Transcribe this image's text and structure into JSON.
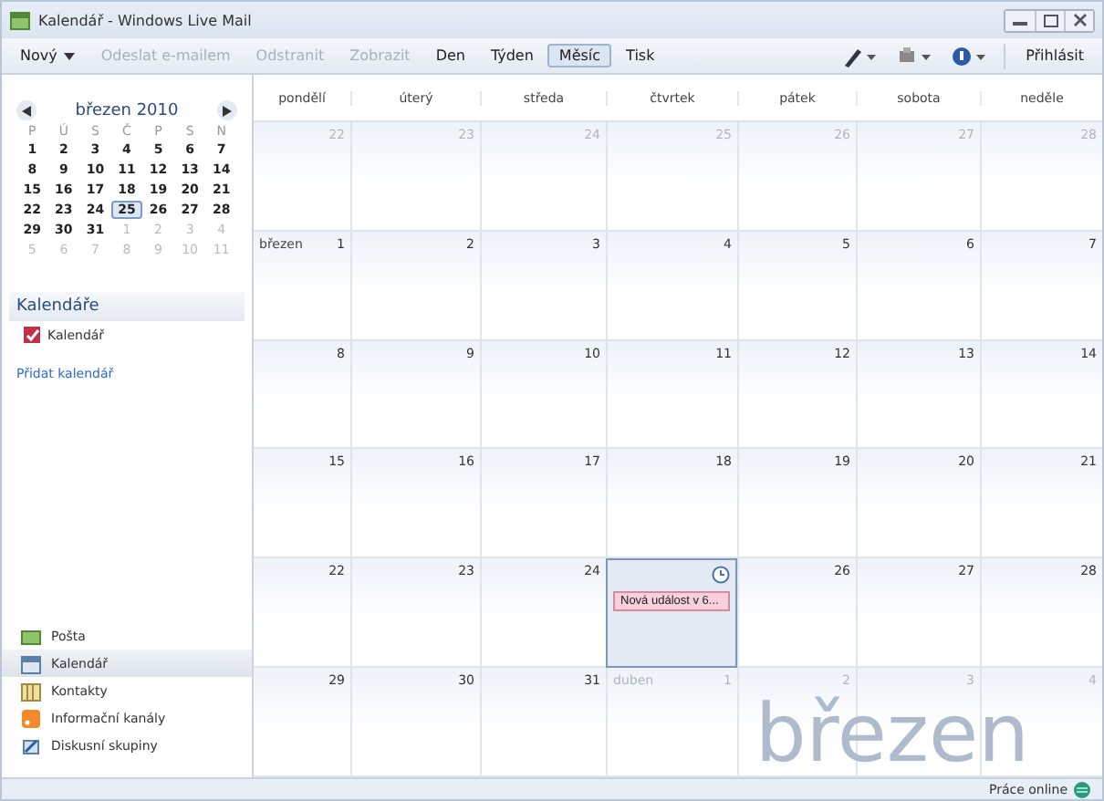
{
  "window": {
    "title": "Kalendář - Windows Live Mail"
  },
  "toolbar": {
    "left": [
      {
        "label": "Nový",
        "kind": "menu",
        "disabled": false,
        "selected": false
      },
      {
        "label": "Odeslat e-mailem",
        "kind": "plain",
        "disabled": true,
        "selected": false
      },
      {
        "label": "Odstranit",
        "kind": "plain",
        "disabled": true,
        "selected": false
      },
      {
        "label": "Zobrazit",
        "kind": "plain",
        "disabled": true,
        "selected": false
      },
      {
        "label": "Den",
        "kind": "plain",
        "disabled": false,
        "selected": false
      },
      {
        "label": "Týden",
        "kind": "plain",
        "disabled": false,
        "selected": false
      },
      {
        "label": "Měsíc",
        "kind": "plain",
        "disabled": false,
        "selected": true
      },
      {
        "label": "Tisk",
        "kind": "plain",
        "disabled": false,
        "selected": false
      }
    ],
    "signin": "Přihlásit"
  },
  "mini_calendar": {
    "title": "březen 2010",
    "weekdays": [
      "P",
      "Ú",
      "S",
      "Č",
      "P",
      "S",
      "N"
    ],
    "weeks": [
      [
        {
          "d": "1",
          "other": false,
          "today": false
        },
        {
          "d": "2",
          "other": false,
          "today": false
        },
        {
          "d": "3",
          "other": false,
          "today": false
        },
        {
          "d": "4",
          "other": false,
          "today": false
        },
        {
          "d": "5",
          "other": false,
          "today": false
        },
        {
          "d": "6",
          "other": false,
          "today": false
        },
        {
          "d": "7",
          "other": false,
          "today": false
        }
      ],
      [
        {
          "d": "8",
          "other": false,
          "today": false
        },
        {
          "d": "9",
          "other": false,
          "today": false
        },
        {
          "d": "10",
          "other": false,
          "today": false
        },
        {
          "d": "11",
          "other": false,
          "today": false
        },
        {
          "d": "12",
          "other": false,
          "today": false
        },
        {
          "d": "13",
          "other": false,
          "today": false
        },
        {
          "d": "14",
          "other": false,
          "today": false
        }
      ],
      [
        {
          "d": "15",
          "other": false,
          "today": false
        },
        {
          "d": "16",
          "other": false,
          "today": false
        },
        {
          "d": "17",
          "other": false,
          "today": false
        },
        {
          "d": "18",
          "other": false,
          "today": false
        },
        {
          "d": "19",
          "other": false,
          "today": false
        },
        {
          "d": "20",
          "other": false,
          "today": false
        },
        {
          "d": "21",
          "other": false,
          "today": false
        }
      ],
      [
        {
          "d": "22",
          "other": false,
          "today": false
        },
        {
          "d": "23",
          "other": false,
          "today": false
        },
        {
          "d": "24",
          "other": false,
          "today": false
        },
        {
          "d": "25",
          "other": false,
          "today": true
        },
        {
          "d": "26",
          "other": false,
          "today": false
        },
        {
          "d": "27",
          "other": false,
          "today": false
        },
        {
          "d": "28",
          "other": false,
          "today": false
        }
      ],
      [
        {
          "d": "29",
          "other": false,
          "today": false
        },
        {
          "d": "30",
          "other": false,
          "today": false
        },
        {
          "d": "31",
          "other": false,
          "today": false
        },
        {
          "d": "1",
          "other": true,
          "today": false
        },
        {
          "d": "2",
          "other": true,
          "today": false
        },
        {
          "d": "3",
          "other": true,
          "today": false
        },
        {
          "d": "4",
          "other": true,
          "today": false
        }
      ],
      [
        {
          "d": "5",
          "other": true,
          "today": false
        },
        {
          "d": "6",
          "other": true,
          "today": false
        },
        {
          "d": "7",
          "other": true,
          "today": false
        },
        {
          "d": "8",
          "other": true,
          "today": false
        },
        {
          "d": "9",
          "other": true,
          "today": false
        },
        {
          "d": "10",
          "other": true,
          "today": false
        },
        {
          "d": "11",
          "other": true,
          "today": false
        }
      ]
    ]
  },
  "calendars": {
    "header": "Kalendáře",
    "items": [
      {
        "label": "Kalendář",
        "checked": true,
        "color": "#c0304a"
      }
    ],
    "add_link": "Přidat kalendář"
  },
  "nav": [
    {
      "label": "Pošta",
      "selected": false
    },
    {
      "label": "Kalendář",
      "selected": true
    },
    {
      "label": "Kontakty",
      "selected": false
    },
    {
      "label": "Informační kanály",
      "selected": false
    },
    {
      "label": "Diskusní skupiny",
      "selected": false
    }
  ],
  "month": {
    "weekdays": [
      "pondělí",
      "úterý",
      "středa",
      "čtvrtek",
      "pátek",
      "sobota",
      "neděle"
    ],
    "watermark": "březen",
    "weeks": [
      [
        {
          "day": "22",
          "adjacent_month": true
        },
        {
          "day": "23",
          "adjacent_month": true
        },
        {
          "day": "24",
          "adjacent_month": true
        },
        {
          "day": "25",
          "adjacent_month": true
        },
        {
          "day": "26",
          "adjacent_month": true
        },
        {
          "day": "27",
          "adjacent_month": true
        },
        {
          "day": "28",
          "adjacent_month": true
        }
      ],
      [
        {
          "day": "1",
          "month_label": "březen",
          "adjacent_month": false
        },
        {
          "day": "2",
          "adjacent_month": false
        },
        {
          "day": "3",
          "adjacent_month": false
        },
        {
          "day": "4",
          "adjacent_month": false
        },
        {
          "day": "5",
          "adjacent_month": false
        },
        {
          "day": "6",
          "adjacent_month": false
        },
        {
          "day": "7",
          "adjacent_month": false
        }
      ],
      [
        {
          "day": "8",
          "adjacent_month": false
        },
        {
          "day": "9",
          "adjacent_month": false
        },
        {
          "day": "10",
          "adjacent_month": false
        },
        {
          "day": "11",
          "adjacent_month": false
        },
        {
          "day": "12",
          "adjacent_month": false
        },
        {
          "day": "13",
          "adjacent_month": false
        },
        {
          "day": "14",
          "adjacent_month": false
        }
      ],
      [
        {
          "day": "15",
          "adjacent_month": false
        },
        {
          "day": "16",
          "adjacent_month": false
        },
        {
          "day": "17",
          "adjacent_month": false
        },
        {
          "day": "18",
          "adjacent_month": false
        },
        {
          "day": "19",
          "adjacent_month": false
        },
        {
          "day": "20",
          "adjacent_month": false
        },
        {
          "day": "21",
          "adjacent_month": false
        }
      ],
      [
        {
          "day": "22",
          "adjacent_month": false
        },
        {
          "day": "23",
          "adjacent_month": false
        },
        {
          "day": "24",
          "adjacent_month": false
        },
        {
          "today": true,
          "events": [
            "Nová událost v 6..."
          ]
        },
        {
          "day": "26",
          "adjacent_month": false
        },
        {
          "day": "27",
          "adjacent_month": false
        },
        {
          "day": "28",
          "adjacent_month": false
        }
      ],
      [
        {
          "day": "29",
          "adjacent_month": false
        },
        {
          "day": "30",
          "adjacent_month": false
        },
        {
          "day": "31",
          "adjacent_month": false
        },
        {
          "day": "1",
          "month_label": "duben",
          "adjacent_month": true
        },
        {
          "day": "2",
          "adjacent_month": true
        },
        {
          "day": "3",
          "adjacent_month": true
        },
        {
          "day": "4",
          "adjacent_month": true
        }
      ]
    ]
  },
  "status_bar": {
    "text": "Práce online"
  }
}
